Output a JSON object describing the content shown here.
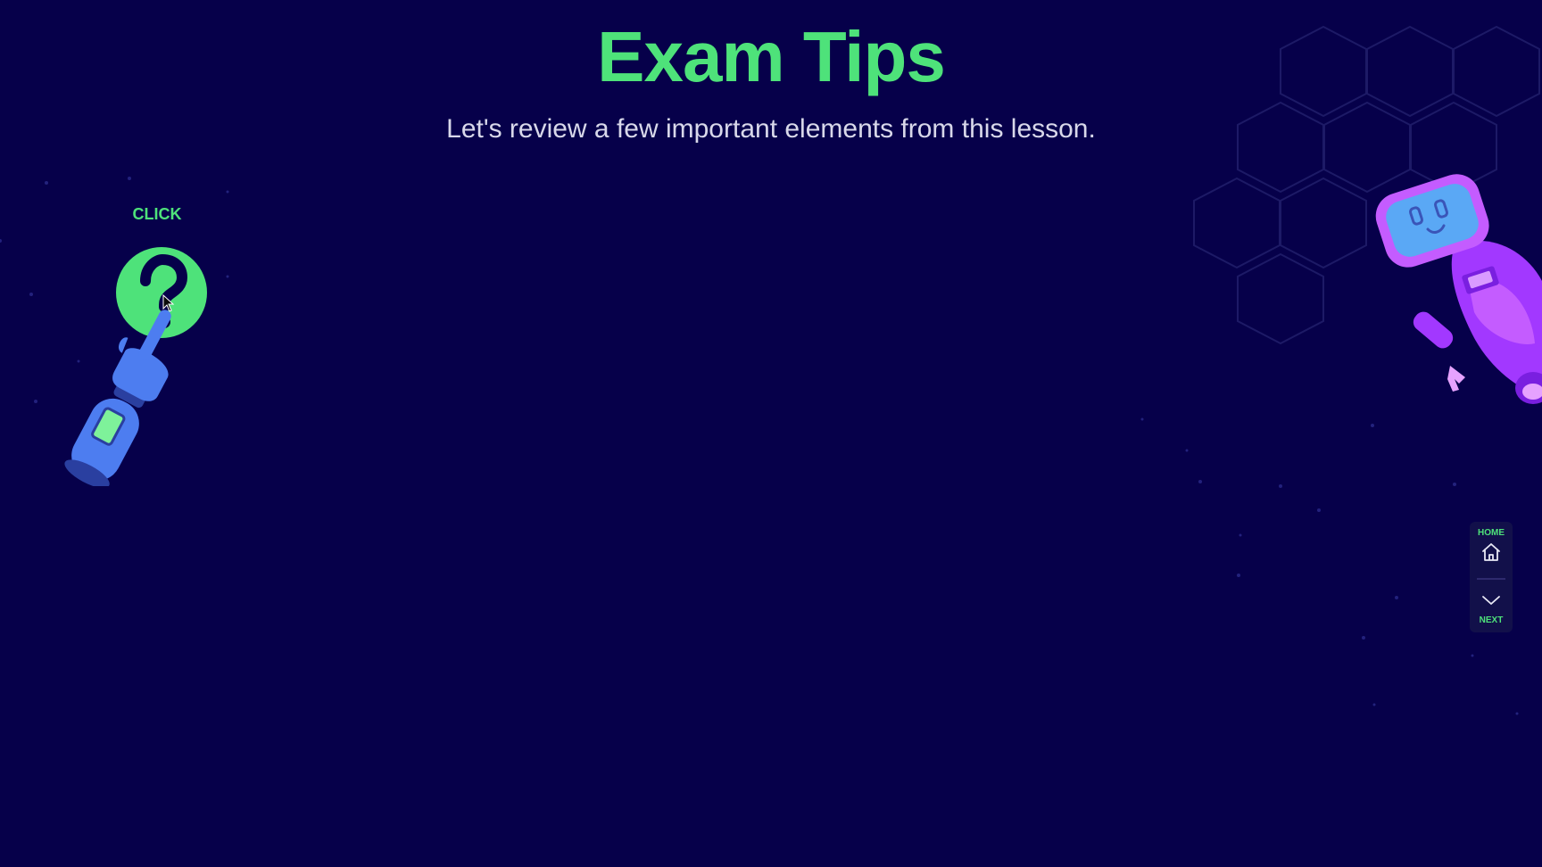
{
  "page": {
    "title": "Exam Tips",
    "subtitle": "Let's review a few important elements from this lesson."
  },
  "prompt": {
    "click_label": "CLICK",
    "button_icon": "question-mark-icon"
  },
  "nav": {
    "home_label": "HOME",
    "next_label": "NEXT",
    "home_icon": "home-icon",
    "next_icon": "chevron-down-icon"
  },
  "colors": {
    "background": "#06004a",
    "accent": "#4ee27a",
    "text": "#d8d8ea",
    "robot_purple": "#a238ff",
    "robot_screen": "#5aa8f5",
    "hand_blue": "#4d7df0"
  }
}
